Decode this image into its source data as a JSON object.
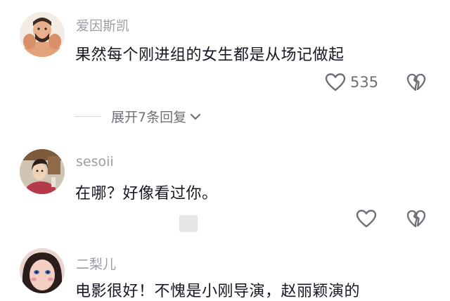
{
  "comments": [
    {
      "username": "爱因斯凯",
      "text": "果然每个刚进组的女生都是从场记做起",
      "like_count": "535"
    },
    {
      "username": "sesoii",
      "text": "在哪？好像看过你。",
      "like_count": ""
    },
    {
      "username": "二梨儿",
      "text": "电影很好！不愧是小刚导演，赵丽颖演的"
    }
  ],
  "replies": {
    "label": "展开7条回复"
  },
  "colors": {
    "username": "#9b9ea6",
    "text": "#161823",
    "meta": "#6e7078"
  },
  "icons": {
    "like": "heart-outline-icon",
    "dislike": "broken-heart-icon",
    "expand": "chevron-down-icon"
  }
}
